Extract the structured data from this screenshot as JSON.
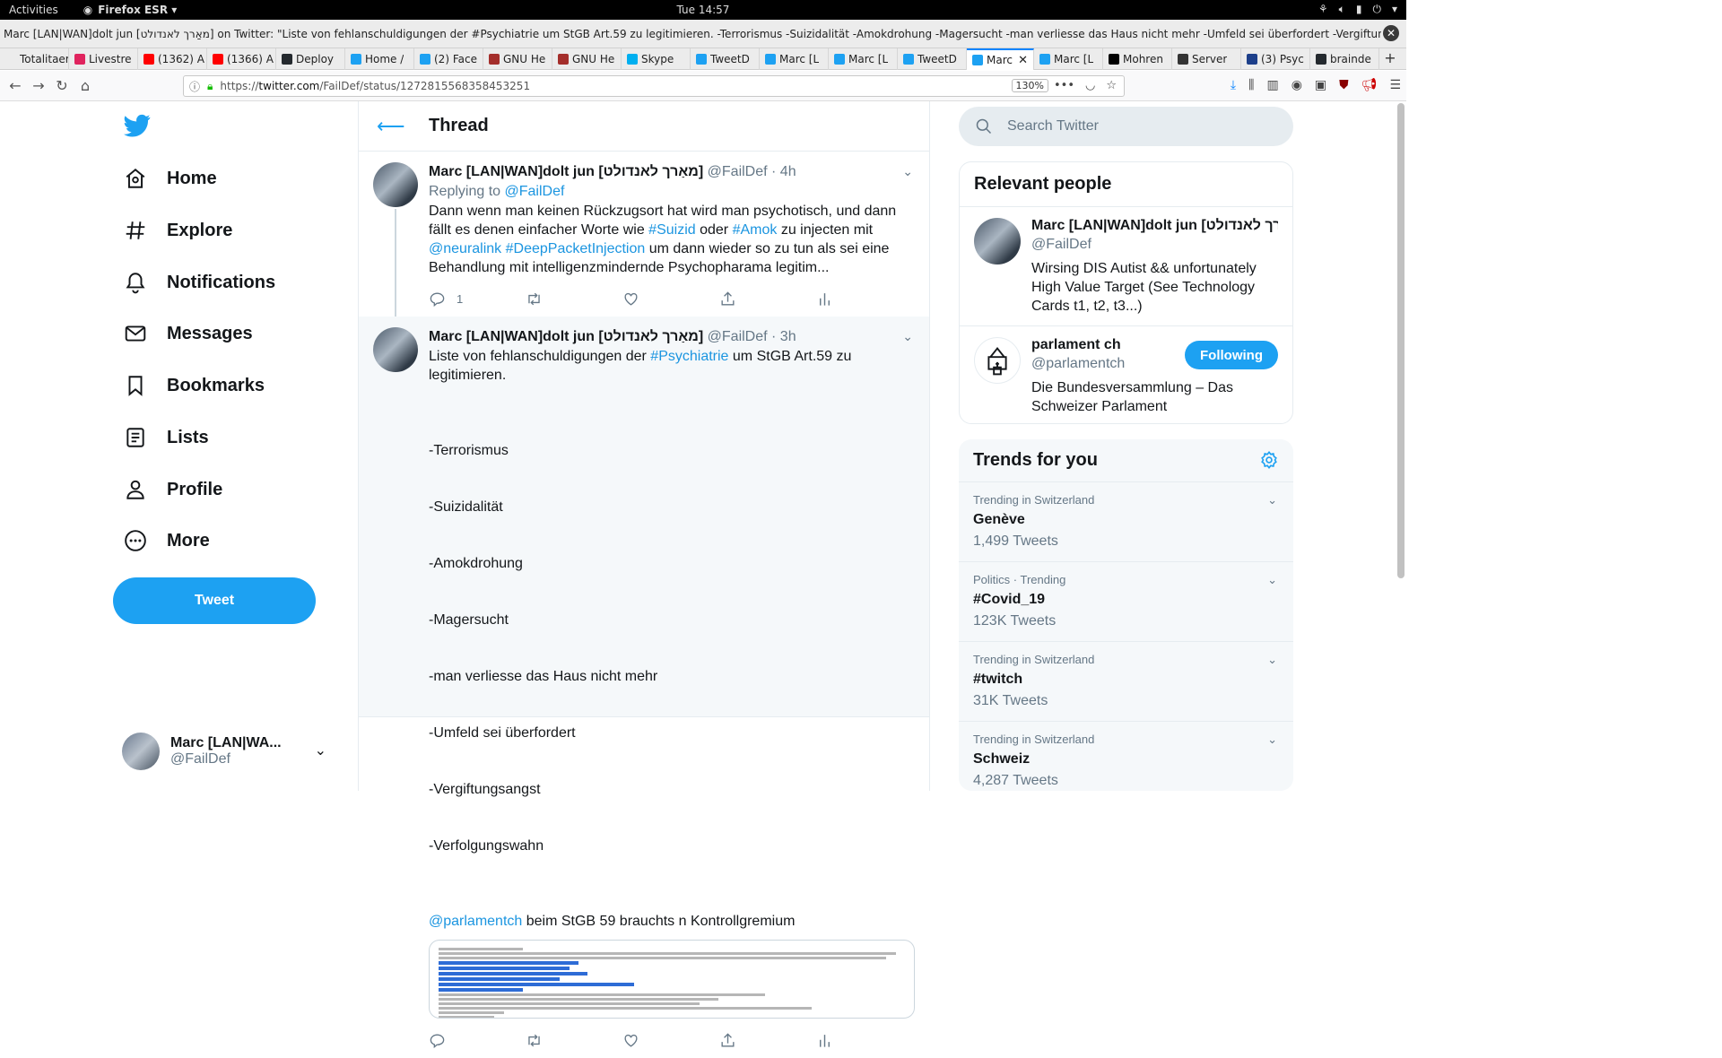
{
  "gnome": {
    "activities": "Activities",
    "app": "Firefox ESR ▾",
    "clock": "Tue 14:57"
  },
  "window": {
    "title": "Marc [LAN|WAN]dolt jun [מאַרך לאנדולט] on Twitter: \"Liste von fehlanschuldigungen der #Psychiatrie um StGB Art.59 zu legitimieren. -Terrorismus -Suizidalität -Amokdrohung -Magersucht -man verliesse das Haus nicht mehr -Umfeld sei überfordert -Vergiftungsangst -Verfolgungs..."
  },
  "tabs": [
    {
      "label": "Totalitaer",
      "icon": "page-icon",
      "color": "#ececec"
    },
    {
      "label": "Livestre",
      "icon": "live-icon",
      "color": "#e0245e"
    },
    {
      "label": "(1362) A",
      "icon": "youtube-icon",
      "color": "#ff0000"
    },
    {
      "label": "(1366) A",
      "icon": "youtube-icon",
      "color": "#ff0000"
    },
    {
      "label": "Deploy",
      "icon": "github-icon",
      "color": "#24292e"
    },
    {
      "label": "Home /",
      "icon": "twitter-icon",
      "color": "#1da1f2"
    },
    {
      "label": "(2) Face",
      "icon": "tweetdeck-icon",
      "color": "#1da1f2"
    },
    {
      "label": "GNU He",
      "icon": "gnu-icon",
      "color": "#a42e2b"
    },
    {
      "label": "GNU He",
      "icon": "gnu-icon",
      "color": "#a42e2b"
    },
    {
      "label": "Skype",
      "icon": "skype-icon",
      "color": "#00aff0"
    },
    {
      "label": "TweetD",
      "icon": "tweetdeck-icon",
      "color": "#1da1f2"
    },
    {
      "label": "Marc [L",
      "icon": "twitter-icon",
      "color": "#1da1f2"
    },
    {
      "label": "Marc [L",
      "icon": "twitter-icon",
      "color": "#1da1f2"
    },
    {
      "label": "TweetD",
      "icon": "tweetdeck-icon",
      "color": "#1da1f2"
    },
    {
      "label": "Marc",
      "icon": "twitter-icon",
      "color": "#1da1f2",
      "active": true
    },
    {
      "label": "Marc [L",
      "icon": "twitter-icon",
      "color": "#1da1f2"
    },
    {
      "label": "Mohren",
      "icon": "nzz-icon",
      "color": "#000000"
    },
    {
      "label": "Server",
      "icon": "warning-icon",
      "color": "#333333"
    },
    {
      "label": "(3) Psyc",
      "icon": "az-icon",
      "color": "#1d3f8a"
    },
    {
      "label": "brainde",
      "icon": "github-icon",
      "color": "#24292e"
    }
  ],
  "urlbar": {
    "url_prefix": "https://",
    "url_domain": "twitter.com",
    "url_path": "/FailDef/status/1272815568358453251",
    "zoom": "130%"
  },
  "nav": {
    "items": [
      {
        "name": "nav-home",
        "label": "Home"
      },
      {
        "name": "nav-explore",
        "label": "Explore"
      },
      {
        "name": "nav-notifications",
        "label": "Notifications"
      },
      {
        "name": "nav-messages",
        "label": "Messages"
      },
      {
        "name": "nav-bookmarks",
        "label": "Bookmarks"
      },
      {
        "name": "nav-lists",
        "label": "Lists"
      },
      {
        "name": "nav-profile",
        "label": "Profile"
      },
      {
        "name": "nav-more",
        "label": "More"
      }
    ],
    "tweet_button": "Tweet",
    "account_name": "Marc [LAN|WA...",
    "account_handle": "@FailDef"
  },
  "thread": {
    "title": "Thread",
    "tweets": [
      {
        "name": "Marc [LAN|WAN]dolt jun [מאַרך לאנדולט]",
        "meta": "@FailDef · 4h",
        "replying_to_prefix": "Replying to ",
        "replying_to": "@FailDef",
        "body_parts": [
          "Dann wenn man keinen Rückzugsort hat wird man psychotisch, und dann fällt es denen einfacher Worte wie ",
          "#Suizid",
          " oder ",
          "#Amok",
          " zu injecten mit ",
          "@neuralink",
          " ",
          "#DeepPacketInjection",
          " um dann wieder so zu tun als sei eine Behandlung mit intelligenzmindernde Psychopharama legitim..."
        ],
        "reply_count": "1"
      },
      {
        "name": "Marc [LAN|WAN]dolt jun [מאַרך לאנדולט]",
        "meta": "@FailDef · 3h",
        "body_intro": "Liste von fehlanschuldigungen der ",
        "body_hashtag": "#Psychiatrie",
        "body_intro_end": " um StGB Art.59 zu legitimieren.",
        "list": [
          "-Terrorismus",
          "-Suizidalität",
          "-Amokdrohung",
          "-Magersucht",
          "-man verliesse das Haus nicht mehr",
          "-Umfeld sei überfordert",
          "-Vergiftungsangst",
          "-Verfolgungswahn"
        ],
        "mention": "@parlamentch",
        "mention_rest": " beim StGB 59 brauchts n Kontrollgremium"
      }
    ]
  },
  "search": {
    "placeholder": "Search Twitter"
  },
  "relevant": {
    "title": "Relevant people",
    "people": [
      {
        "name": "Marc [LAN|WAN]dolt jun [מאַרך לאנדולט]",
        "handle": "@FailDef",
        "bio": "Wirsing DIS Autist && unfortunately High Value Target (See Technology Cards t1, t2, t3...)"
      },
      {
        "name": "parlament ch",
        "handle": "@parlamentch",
        "bio": "Die Bundesversammlung – Das Schweizer Parlament",
        "button": "Following"
      }
    ]
  },
  "trends": {
    "title": "Trends for you",
    "items": [
      {
        "context": "Trending in Switzerland",
        "name": "Genève",
        "count": "1,499 Tweets"
      },
      {
        "context": "Politics · Trending",
        "name": "#Covid_19",
        "count": "123K Tweets"
      },
      {
        "context": "Trending in Switzerland",
        "name": "#twitch",
        "count": "31K Tweets"
      },
      {
        "context": "Trending in Switzerland",
        "name": "Schweiz",
        "count": "4,287 Tweets"
      }
    ]
  },
  "colors": {
    "twitter_blue": "#1da1f2",
    "link_blue": "#1b95e0",
    "muted": "#657786"
  }
}
